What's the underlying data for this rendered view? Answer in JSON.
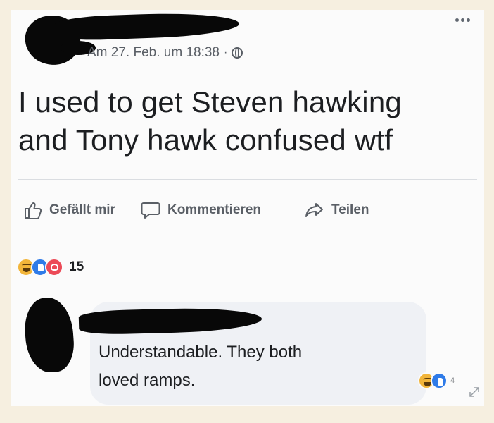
{
  "post": {
    "timestamp": "Am 27. Feb. um 18:38",
    "separator": "·",
    "privacy_icon": "globe-icon",
    "text_line1": "I used to get Steven hawking",
    "text_line2": "and Tony hawk confused wtf",
    "more_icon": "more-options-icon"
  },
  "actions": {
    "like_label": "Gefällt mir",
    "comment_label": "Kommentieren",
    "share_label": "Teilen"
  },
  "reactions": {
    "icons": [
      "haha-reaction-icon",
      "like-reaction-icon",
      "love-reaction-icon"
    ],
    "count": "15"
  },
  "comment": {
    "text_line1": "Understandable. They both",
    "text_line2": "loved ramps.",
    "reaction_icons": [
      "haha-reaction-icon",
      "like-reaction-icon"
    ],
    "reaction_count": "4"
  },
  "colors": {
    "page_background": "#f6efe0",
    "card_background": "#fbfbfb",
    "bubble_background": "#eff1f5",
    "meta_text": "#5a5f66",
    "like_blue": "#2f7be8",
    "love_red": "#ec4a57",
    "haha_yellow": "#f2b53a"
  }
}
